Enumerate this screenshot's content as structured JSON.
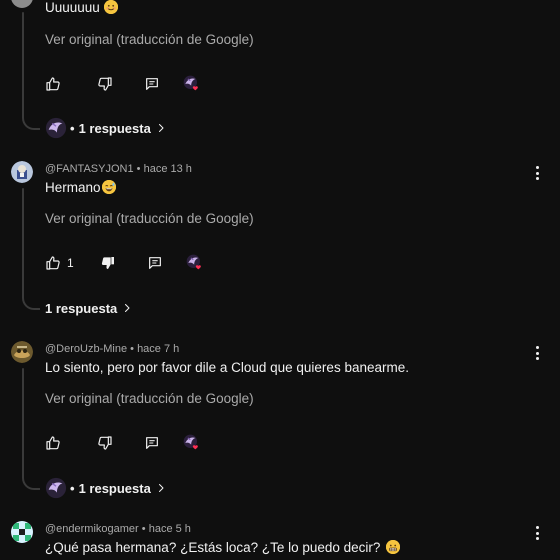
{
  "colors": {
    "background": "#0f0f0f",
    "text": "#f1f1f1",
    "muted": "#aaaaaa",
    "heart": "#ff2f55"
  },
  "comments": [
    {
      "author": "",
      "time": "",
      "text": "Uuuuuuu",
      "translate_link": "Ver original (traducción de Google)",
      "likes": "",
      "replies_label": "1 respuesta",
      "emoji": "smiling-face"
    },
    {
      "author": "@FANTASYJON1",
      "time": "hace 13 h",
      "text": "Hermano",
      "translate_link": "Ver original (traducción de Google)",
      "likes": "1",
      "replies_label": "1 respuesta",
      "emoji": "grinning-sweat-face"
    },
    {
      "author": "@DeroUzb-Mine",
      "time": "hace 7 h",
      "text": "Lo siento, pero por favor dile a Cloud que quieres banearme.",
      "translate_link": "Ver original (traducción de Google)",
      "likes": "",
      "replies_label": "1 respuesta",
      "emoji": ""
    },
    {
      "author": "@endermikogamer",
      "time": "hace 5 h",
      "text": "¿Qué pasa hermana? ¿Estás loca? ¿Te lo puedo decir?",
      "translate_link": "",
      "likes": "",
      "replies_label": "",
      "emoji": "grimacing-face"
    }
  ],
  "meta_separator": "•",
  "icons": [
    "like-icon",
    "dislike-icon",
    "reply-icon",
    "creator-heart-icon",
    "more-vert-icon",
    "chevron-right-icon"
  ]
}
